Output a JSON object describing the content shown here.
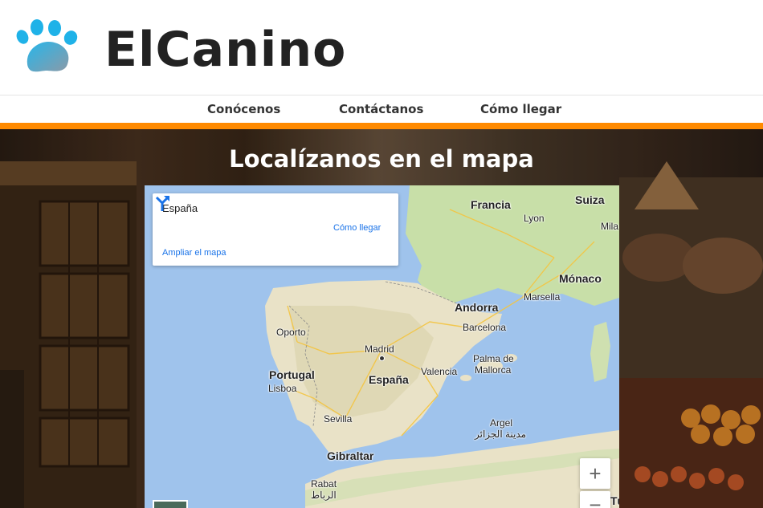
{
  "brand": {
    "name": "ElCanino",
    "logo_icon": "paw-icon"
  },
  "nav": {
    "items": [
      "Conócenos",
      "Contáctanos",
      "Cómo llegar"
    ]
  },
  "colors": {
    "accent": "#ff8a00",
    "link": "#1a73e8"
  },
  "hero": {
    "title": "Localízanos en el mapa"
  },
  "map": {
    "info": {
      "place": "España",
      "directions_label": "Cómo llegar",
      "enlarge_label": "Ampliar el mapa"
    },
    "zoom": {
      "in": "+",
      "out": "−"
    },
    "labels": {
      "francia": "Francia",
      "suiza": "Suiza",
      "lyon": "Lyon",
      "mila": "Mila",
      "monaco": "Mónaco",
      "marsella": "Marsella",
      "andorra": "Andorra",
      "barcelona": "Barcelona",
      "oporto": "Oporto",
      "madrid": "Madrid",
      "palma": "Palma de",
      "mallorca": "Mallorca",
      "portugal": "Portugal",
      "lisboa": "Lisboa",
      "espana": "España",
      "valencia": "Valencia",
      "sevilla": "Sevilla",
      "argel": "Argel",
      "argel_ar": "مدينة الجزائر",
      "gibraltar": "Gibraltar",
      "rabat": "Rabat",
      "rabat_ar": "الرباط",
      "tu": "Tú"
    }
  }
}
